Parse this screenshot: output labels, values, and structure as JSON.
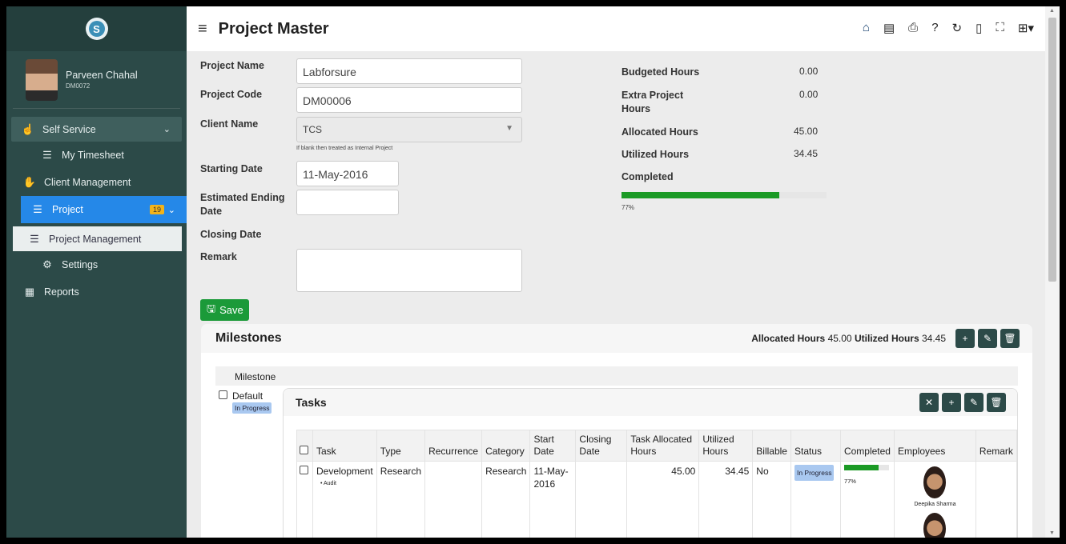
{
  "sidebar": {
    "user": {
      "name": "Parveen Chahal",
      "code": "DM0072"
    },
    "items": [
      {
        "label": "Self Service"
      },
      {
        "label": "My Timesheet"
      },
      {
        "label": "Client Management"
      },
      {
        "label": "Project",
        "badge": "19"
      },
      {
        "label": "Project Management"
      },
      {
        "label": "Settings"
      },
      {
        "label": "Reports"
      }
    ]
  },
  "header": {
    "title": "Project Master",
    "tools": [
      "home-icon",
      "pdf-icon",
      "print-icon",
      "help-icon",
      "refresh-icon",
      "copy-icon",
      "fullscreen-icon",
      "grid-menu-icon"
    ]
  },
  "form": {
    "project_name_label": "Project Name",
    "project_name": "Labforsure",
    "project_code_label": "Project Code",
    "project_code": "DM00006",
    "client_name_label": "Client Name",
    "client_name": "TCS",
    "client_hint": "If blank then treated as Internal Project",
    "starting_date_label": "Starting Date",
    "starting_date": "11-May-2016",
    "est_end_label_1": "Estimated Ending",
    "est_end_label_2": "Date",
    "est_end_value": "",
    "closing_label": "Closing Date",
    "remark_label": "Remark",
    "remark_value": "",
    "save_label": "Save"
  },
  "summary": {
    "budgeted_label": "Budgeted Hours",
    "budgeted": "0.00",
    "extra_label_1": "Extra Project",
    "extra_label_2": "Hours",
    "extra": "0.00",
    "allocated_label": "Allocated Hours",
    "allocated": "45.00",
    "utilized_label": "Utilized Hours",
    "utilized": "34.45",
    "completed_label": "Completed",
    "completed_pct": "77%",
    "completed_value": 0.77
  },
  "milestones": {
    "title": "Milestones",
    "allocated_label": "Allocated Hours",
    "allocated": "45.00",
    "utilized_label": "Utilized Hours",
    "utilized": "34.45",
    "col_label": "Milestone",
    "row": {
      "name": "Default",
      "status": "In Progress"
    }
  },
  "tasks": {
    "title": "Tasks",
    "headers": [
      "Task",
      "Type",
      "Recurrence",
      "Category",
      "Start Date",
      "Closing Date",
      "Task Allocated Hours",
      "Utilized Hours",
      "Billable",
      "Status",
      "Completed",
      "Employees",
      "Remark"
    ],
    "row": {
      "task": "Development",
      "sub": "Audit",
      "type": "Research",
      "recurrence": "",
      "category": "Research",
      "start": "11-May-2016",
      "closing": "",
      "alloc": "45.00",
      "utilized": "34.45",
      "billable": "No",
      "status": "In Progress",
      "completed_pct": "77%",
      "completed_value": 0.77,
      "employee": "Deepika Sharma",
      "remark": ""
    }
  },
  "colors": {
    "sidebar": "#2c4a48",
    "active": "#2588e8",
    "save": "#1b9a39",
    "progress": "#1b9a25",
    "badge": "#f2b31a"
  }
}
